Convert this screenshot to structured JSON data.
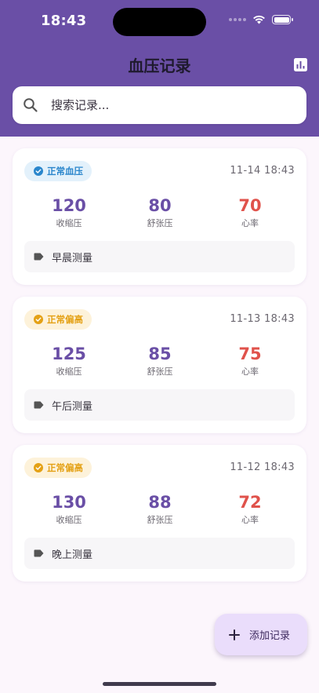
{
  "status_bar": {
    "time": "18:43"
  },
  "header": {
    "title": "血压记录",
    "stats_icon": "bar-chart-icon"
  },
  "search": {
    "placeholder": "搜索记录..."
  },
  "labels": {
    "systolic": "收缩压",
    "diastolic": "舒张压",
    "heart_rate": "心率"
  },
  "records": [
    {
      "status": "正常血压",
      "status_type": "normal",
      "datetime": "11-14 18:43",
      "systolic": "120",
      "diastolic": "80",
      "heart_rate": "70",
      "note": "早晨测量"
    },
    {
      "status": "正常偏高",
      "status_type": "high",
      "datetime": "11-13 18:43",
      "systolic": "125",
      "diastolic": "85",
      "heart_rate": "75",
      "note": "午后测量"
    },
    {
      "status": "正常偏高",
      "status_type": "high",
      "datetime": "11-12 18:43",
      "systolic": "130",
      "diastolic": "88",
      "heart_rate": "72",
      "note": "晚上测量"
    }
  ],
  "fab": {
    "label": "添加记录",
    "icon": "plus-icon"
  },
  "colors": {
    "primary": "#6A4FA6",
    "heart_rate": "#E0524B",
    "normal_badge": "#2A86CC",
    "high_badge": "#E4A115",
    "fab_bg": "#EADDFB"
  }
}
